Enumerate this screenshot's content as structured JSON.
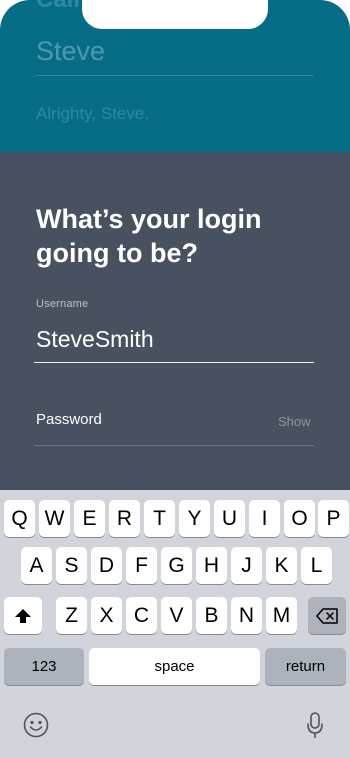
{
  "top": {
    "cut_title": "Call",
    "name_value": "Steve",
    "greeting": "Alrighty, Steve."
  },
  "login": {
    "heading": "What’s your login going to be?",
    "username_label": "Username",
    "username_value": "SteveSmith",
    "password_placeholder": "Password",
    "show_label": "Show"
  },
  "keyboard": {
    "row1": [
      "Q",
      "W",
      "E",
      "R",
      "T",
      "Y",
      "U",
      "I",
      "O",
      "P"
    ],
    "row2": [
      "A",
      "S",
      "D",
      "F",
      "G",
      "H",
      "J",
      "K",
      "L"
    ],
    "row3": [
      "Z",
      "X",
      "C",
      "V",
      "B",
      "N",
      "M"
    ],
    "numbers_label": "123",
    "space_label": "space",
    "return_label": "return",
    "shift_icon": "shift-icon",
    "delete_icon": "delete-icon",
    "emoji_icon": "emoji-icon",
    "mic_icon": "microphone-icon"
  },
  "colors": {
    "teal": "#076d87",
    "slate": "#475160",
    "keyboard_bg": "#d1d4da"
  }
}
